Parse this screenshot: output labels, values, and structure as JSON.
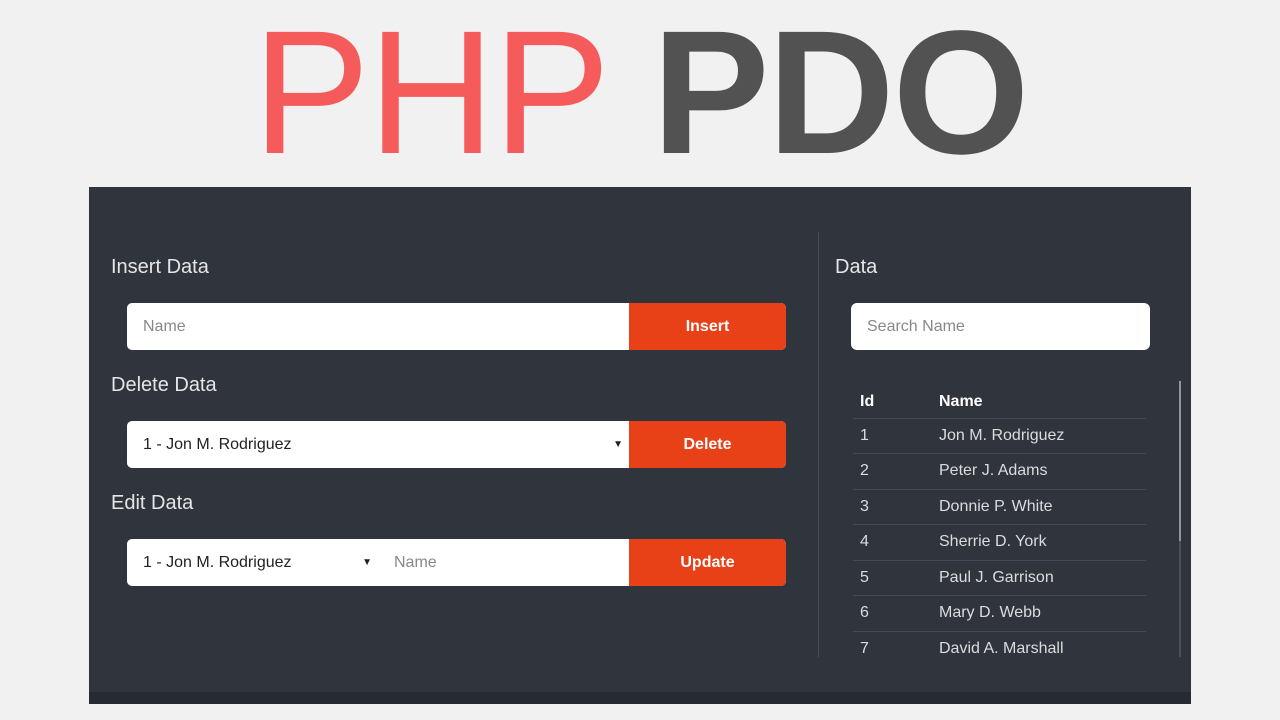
{
  "header": {
    "title_light": "PHP",
    "title_bold": "PDO"
  },
  "insert": {
    "heading": "Insert Data",
    "name_placeholder": "Name",
    "button": "Insert"
  },
  "delete": {
    "heading": "Delete Data",
    "selected": "1 - Jon M. Rodriguez",
    "button": "Delete"
  },
  "edit": {
    "heading": "Edit Data",
    "selected": "1 - Jon M. Rodriguez",
    "name_placeholder": "Name",
    "button": "Update"
  },
  "data": {
    "heading": "Data",
    "search_placeholder": "Search Name",
    "columns": [
      "Id",
      "Name"
    ],
    "rows": [
      [
        "1",
        "Jon M. Rodriguez"
      ],
      [
        "2",
        "Peter J. Adams"
      ],
      [
        "3",
        "Donnie P. White"
      ],
      [
        "4",
        "Sherrie D. York"
      ],
      [
        "5",
        "Paul J. Garrison"
      ],
      [
        "6",
        "Mary D. Webb"
      ],
      [
        "7",
        "David A. Marshall"
      ]
    ]
  },
  "colors": {
    "accent": "#e84118",
    "panel": "#2f343d",
    "title_red": "#f55b5b",
    "title_gray": "#525252"
  }
}
